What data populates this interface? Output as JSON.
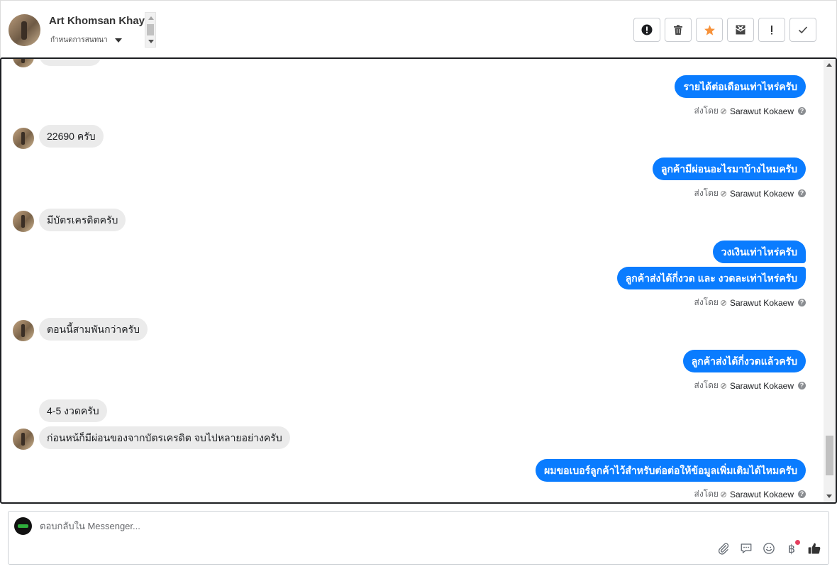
{
  "header": {
    "customer_name": "Art Khomsan Khayan",
    "assign_label": "กำหนดการสนทนา"
  },
  "actions": [
    {
      "name": "mark-spam-button",
      "icon": "exclamation-circle-icon"
    },
    {
      "name": "delete-button",
      "icon": "trash-icon"
    },
    {
      "name": "star-button",
      "icon": "star-icon",
      "color": "#f7923a"
    },
    {
      "name": "mark-unread-button",
      "icon": "envelope-x-icon"
    },
    {
      "name": "follow-up-button",
      "icon": "exclamation-icon",
      "text": "!"
    },
    {
      "name": "mark-done-button",
      "icon": "check-icon"
    }
  ],
  "messages": {
    "out1": "รายได้ต่อเดือนเท่าไหร่ครับ",
    "in1": "22690 ครับ",
    "out2": "ลูกค้ามีผ่อนอะไรมาบ้างไหมครับ",
    "in2": "มีบัตรเครดิตครับ",
    "out3": "วงเงินเท่าไหร่ครับ",
    "out4": "ลูกค้าส่งได้กี่งวด และ งวดละเท่าไหร่ครับ",
    "in3": "ตอนนี้สามพันกว่าครับ",
    "out5": "ลูกค้าส่งได้กี่งวดแล้วครับ",
    "in4": "4-5 งวดครับ",
    "in5": "ก่อนหน้ก็มีผ่อนของจากบัตรเครดิต จบไปหลายอย่างครับ",
    "out6": "ผมขอเบอร์ลูกค้าไว้สำหรับต่อต่อให้ข้อมูลเพิ่มเติมได้ไหมครับ"
  },
  "sent_by": {
    "label": "ส่งโดย",
    "agent": "Sarawut Kokaew",
    "help": "?"
  },
  "composer": {
    "placeholder": "ตอบกลับใน Messenger...",
    "currency_symbol": "฿"
  },
  "colors": {
    "outgoing_bubble": "#0a7cff",
    "incoming_bubble": "#ebebeb",
    "star": "#f7923a",
    "badge": "#e4405f"
  }
}
